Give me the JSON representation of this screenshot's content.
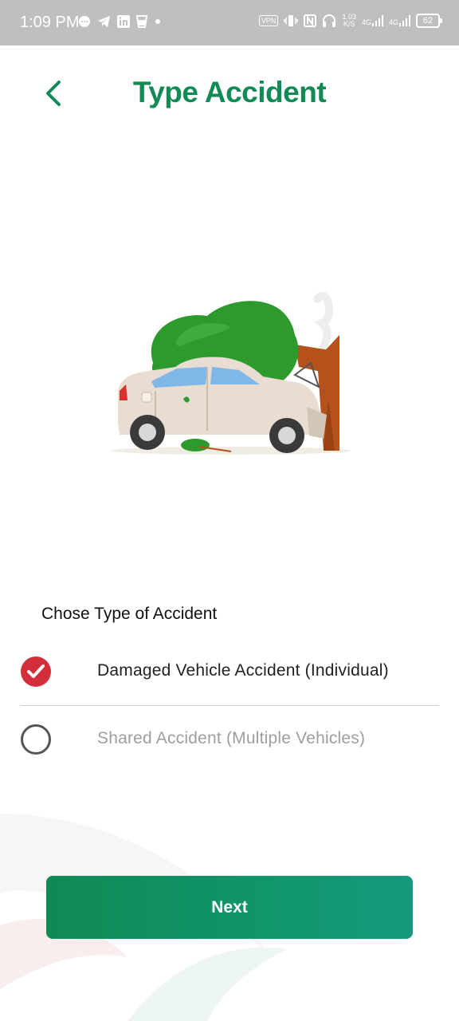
{
  "status_bar": {
    "time": "1:09 PM",
    "vpn_label": "VPN",
    "speed_value": "1.03",
    "speed_unit": "K/S",
    "net1": "4G",
    "net2": "4G",
    "battery": "62",
    "left_icons": [
      "chat-icon",
      "telegram-icon",
      "linkedin-icon",
      "cup-icon",
      "dot-icon"
    ],
    "right_icons": [
      "vpn-icon",
      "vibrate-icon",
      "nfc-icon",
      "headset-icon",
      "speed-indicator",
      "signal-icon",
      "signal-icon",
      "battery-icon"
    ]
  },
  "header": {
    "title": "Type Accident",
    "back_icon": "chevron-left-icon"
  },
  "illustration": {
    "name": "car-crash-into-tree"
  },
  "form": {
    "question": "Chose Type of Accident",
    "options": [
      {
        "label": "Damaged Vehicle Accident (Individual)",
        "selected": true
      },
      {
        "label": "Shared Accident (Multiple Vehicles)",
        "selected": false
      }
    ]
  },
  "actions": {
    "next_label": "Next"
  },
  "colors": {
    "brand_green": "#118a55",
    "selected_red": "#d32f3a",
    "button_gradient_start": "#0f8a56",
    "button_gradient_end": "#16997d"
  }
}
